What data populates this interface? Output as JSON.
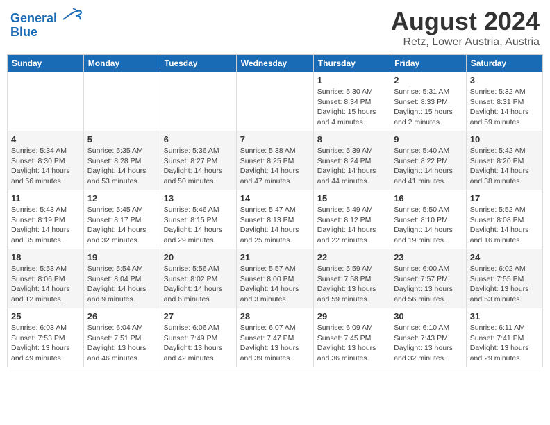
{
  "header": {
    "logo_line1": "General",
    "logo_line2": "Blue",
    "main_title": "August 2024",
    "subtitle": "Retz, Lower Austria, Austria"
  },
  "days_of_week": [
    "Sunday",
    "Monday",
    "Tuesday",
    "Wednesday",
    "Thursday",
    "Friday",
    "Saturday"
  ],
  "weeks": [
    [
      {
        "day": "",
        "info": ""
      },
      {
        "day": "",
        "info": ""
      },
      {
        "day": "",
        "info": ""
      },
      {
        "day": "",
        "info": ""
      },
      {
        "day": "1",
        "info": "Sunrise: 5:30 AM\nSunset: 8:34 PM\nDaylight: 15 hours\nand 4 minutes."
      },
      {
        "day": "2",
        "info": "Sunrise: 5:31 AM\nSunset: 8:33 PM\nDaylight: 15 hours\nand 2 minutes."
      },
      {
        "day": "3",
        "info": "Sunrise: 5:32 AM\nSunset: 8:31 PM\nDaylight: 14 hours\nand 59 minutes."
      }
    ],
    [
      {
        "day": "4",
        "info": "Sunrise: 5:34 AM\nSunset: 8:30 PM\nDaylight: 14 hours\nand 56 minutes."
      },
      {
        "day": "5",
        "info": "Sunrise: 5:35 AM\nSunset: 8:28 PM\nDaylight: 14 hours\nand 53 minutes."
      },
      {
        "day": "6",
        "info": "Sunrise: 5:36 AM\nSunset: 8:27 PM\nDaylight: 14 hours\nand 50 minutes."
      },
      {
        "day": "7",
        "info": "Sunrise: 5:38 AM\nSunset: 8:25 PM\nDaylight: 14 hours\nand 47 minutes."
      },
      {
        "day": "8",
        "info": "Sunrise: 5:39 AM\nSunset: 8:24 PM\nDaylight: 14 hours\nand 44 minutes."
      },
      {
        "day": "9",
        "info": "Sunrise: 5:40 AM\nSunset: 8:22 PM\nDaylight: 14 hours\nand 41 minutes."
      },
      {
        "day": "10",
        "info": "Sunrise: 5:42 AM\nSunset: 8:20 PM\nDaylight: 14 hours\nand 38 minutes."
      }
    ],
    [
      {
        "day": "11",
        "info": "Sunrise: 5:43 AM\nSunset: 8:19 PM\nDaylight: 14 hours\nand 35 minutes."
      },
      {
        "day": "12",
        "info": "Sunrise: 5:45 AM\nSunset: 8:17 PM\nDaylight: 14 hours\nand 32 minutes."
      },
      {
        "day": "13",
        "info": "Sunrise: 5:46 AM\nSunset: 8:15 PM\nDaylight: 14 hours\nand 29 minutes."
      },
      {
        "day": "14",
        "info": "Sunrise: 5:47 AM\nSunset: 8:13 PM\nDaylight: 14 hours\nand 25 minutes."
      },
      {
        "day": "15",
        "info": "Sunrise: 5:49 AM\nSunset: 8:12 PM\nDaylight: 14 hours\nand 22 minutes."
      },
      {
        "day": "16",
        "info": "Sunrise: 5:50 AM\nSunset: 8:10 PM\nDaylight: 14 hours\nand 19 minutes."
      },
      {
        "day": "17",
        "info": "Sunrise: 5:52 AM\nSunset: 8:08 PM\nDaylight: 14 hours\nand 16 minutes."
      }
    ],
    [
      {
        "day": "18",
        "info": "Sunrise: 5:53 AM\nSunset: 8:06 PM\nDaylight: 14 hours\nand 12 minutes."
      },
      {
        "day": "19",
        "info": "Sunrise: 5:54 AM\nSunset: 8:04 PM\nDaylight: 14 hours\nand 9 minutes."
      },
      {
        "day": "20",
        "info": "Sunrise: 5:56 AM\nSunset: 8:02 PM\nDaylight: 14 hours\nand 6 minutes."
      },
      {
        "day": "21",
        "info": "Sunrise: 5:57 AM\nSunset: 8:00 PM\nDaylight: 14 hours\nand 3 minutes."
      },
      {
        "day": "22",
        "info": "Sunrise: 5:59 AM\nSunset: 7:58 PM\nDaylight: 13 hours\nand 59 minutes."
      },
      {
        "day": "23",
        "info": "Sunrise: 6:00 AM\nSunset: 7:57 PM\nDaylight: 13 hours\nand 56 minutes."
      },
      {
        "day": "24",
        "info": "Sunrise: 6:02 AM\nSunset: 7:55 PM\nDaylight: 13 hours\nand 53 minutes."
      }
    ],
    [
      {
        "day": "25",
        "info": "Sunrise: 6:03 AM\nSunset: 7:53 PM\nDaylight: 13 hours\nand 49 minutes."
      },
      {
        "day": "26",
        "info": "Sunrise: 6:04 AM\nSunset: 7:51 PM\nDaylight: 13 hours\nand 46 minutes."
      },
      {
        "day": "27",
        "info": "Sunrise: 6:06 AM\nSunset: 7:49 PM\nDaylight: 13 hours\nand 42 minutes."
      },
      {
        "day": "28",
        "info": "Sunrise: 6:07 AM\nSunset: 7:47 PM\nDaylight: 13 hours\nand 39 minutes."
      },
      {
        "day": "29",
        "info": "Sunrise: 6:09 AM\nSunset: 7:45 PM\nDaylight: 13 hours\nand 36 minutes."
      },
      {
        "day": "30",
        "info": "Sunrise: 6:10 AM\nSunset: 7:43 PM\nDaylight: 13 hours\nand 32 minutes."
      },
      {
        "day": "31",
        "info": "Sunrise: 6:11 AM\nSunset: 7:41 PM\nDaylight: 13 hours\nand 29 minutes."
      }
    ]
  ]
}
